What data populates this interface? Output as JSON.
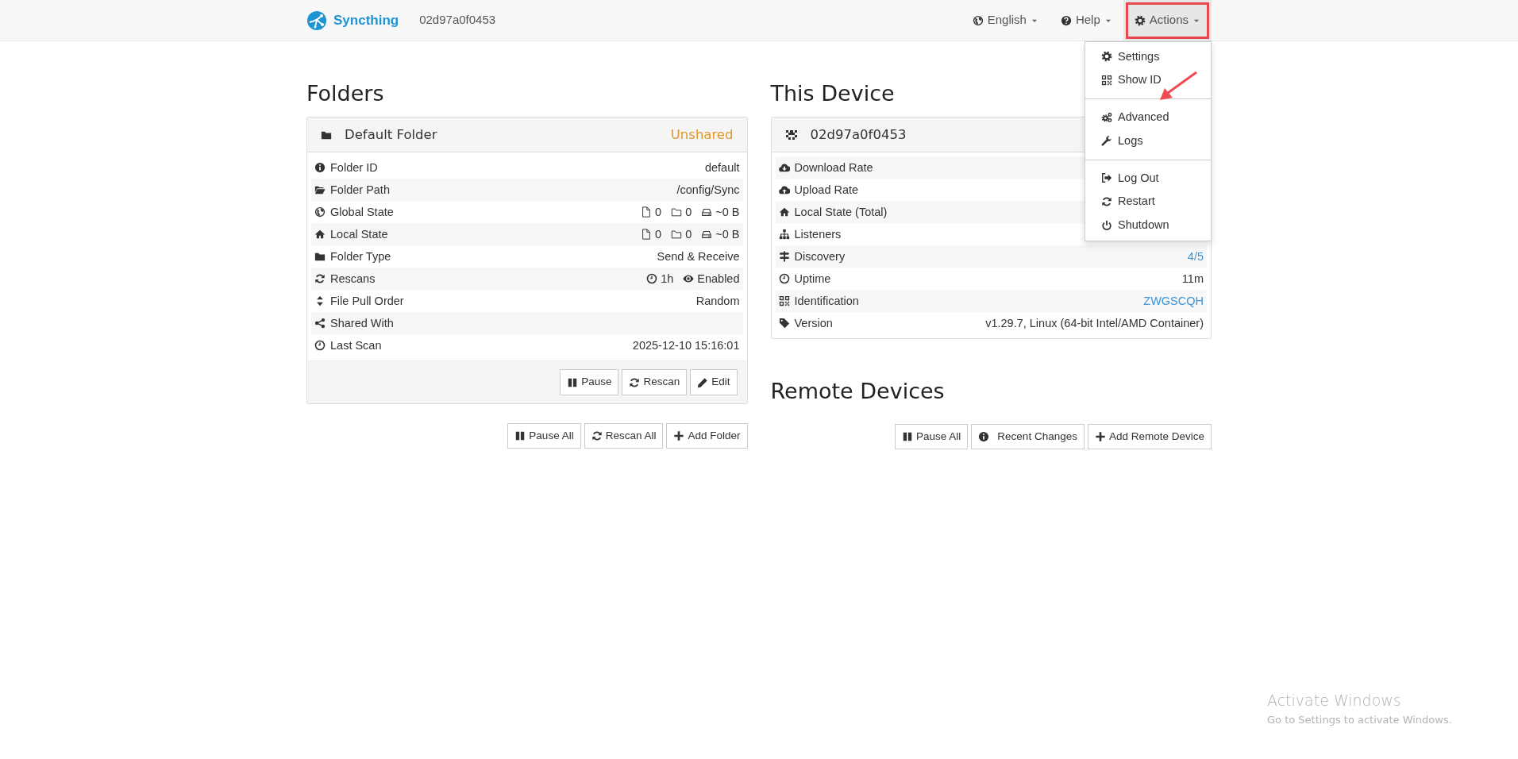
{
  "navbar": {
    "brand": "Syncthing",
    "device_name": "02d97a0f0453",
    "menus": [
      {
        "label": "English",
        "highlighted": false,
        "open": false
      },
      {
        "label": "Help",
        "highlighted": false,
        "open": false
      },
      {
        "label": "Actions",
        "highlighted": true,
        "open": true
      }
    ],
    "actions_menu": [
      [
        {
          "label": "Settings",
          "pointed": false
        },
        {
          "label": "Show ID",
          "pointed": true
        }
      ],
      [
        {
          "label": "Advanced",
          "pointed": false
        },
        {
          "label": "Logs",
          "pointed": false
        }
      ],
      [
        {
          "label": "Log Out",
          "pointed": false
        },
        {
          "label": "Restart",
          "pointed": false
        },
        {
          "label": "Shutdown",
          "pointed": false
        }
      ]
    ]
  },
  "folders": {
    "heading": "Folders",
    "folder": {
      "name": "Default Folder",
      "status": "Unshared",
      "rows": [
        {
          "kind": "text",
          "label": "Folder ID",
          "value": "default"
        },
        {
          "kind": "text",
          "label": "Folder Path",
          "value": "/config/Sync"
        },
        {
          "kind": "counts",
          "label": "Global State",
          "files": "0",
          "dirs": "0",
          "size": "~0 B"
        },
        {
          "kind": "counts",
          "label": "Local State",
          "files": "0",
          "dirs": "0",
          "size": "~0 B"
        },
        {
          "kind": "text",
          "label": "Folder Type",
          "value": "Send & Receive"
        },
        {
          "kind": "rescans",
          "label": "Rescans",
          "interval": "1h",
          "watcher": "Enabled"
        },
        {
          "kind": "text",
          "label": "File Pull Order",
          "value": "Random"
        },
        {
          "kind": "text",
          "label": "Shared With"
        },
        {
          "kind": "text",
          "label": "Last Scan",
          "value": "2025-12-10 15:16:01"
        }
      ],
      "buttons": [
        "Pause",
        "Rescan",
        "Edit"
      ]
    },
    "buttons": [
      "Pause All",
      "Rescan All",
      "Add Folder"
    ]
  },
  "this_device": {
    "heading": "This Device",
    "name": "02d97a0f0453",
    "rows": [
      {
        "label": "Download Rate"
      },
      {
        "label": "Upload Rate"
      },
      {
        "label": "Local State (Total)"
      },
      {
        "label": "Listeners"
      },
      {
        "label": "Discovery",
        "value": "4/5",
        "link": true
      },
      {
        "label": "Uptime",
        "value": "11m",
        "link": false
      },
      {
        "label": "Identification",
        "value": "ZWGSCQH",
        "link": true
      },
      {
        "label": "Version",
        "value": "v1.29.7, Linux (64-bit Intel/AMD Container)",
        "link": false
      }
    ]
  },
  "remote_devices": {
    "heading": "Remote Devices",
    "buttons": [
      "Pause All",
      "Recent Changes",
      "Add Remote Device"
    ]
  },
  "os_notice": {
    "title": "Activate Windows",
    "text": "Go to Settings to activate Windows."
  }
}
